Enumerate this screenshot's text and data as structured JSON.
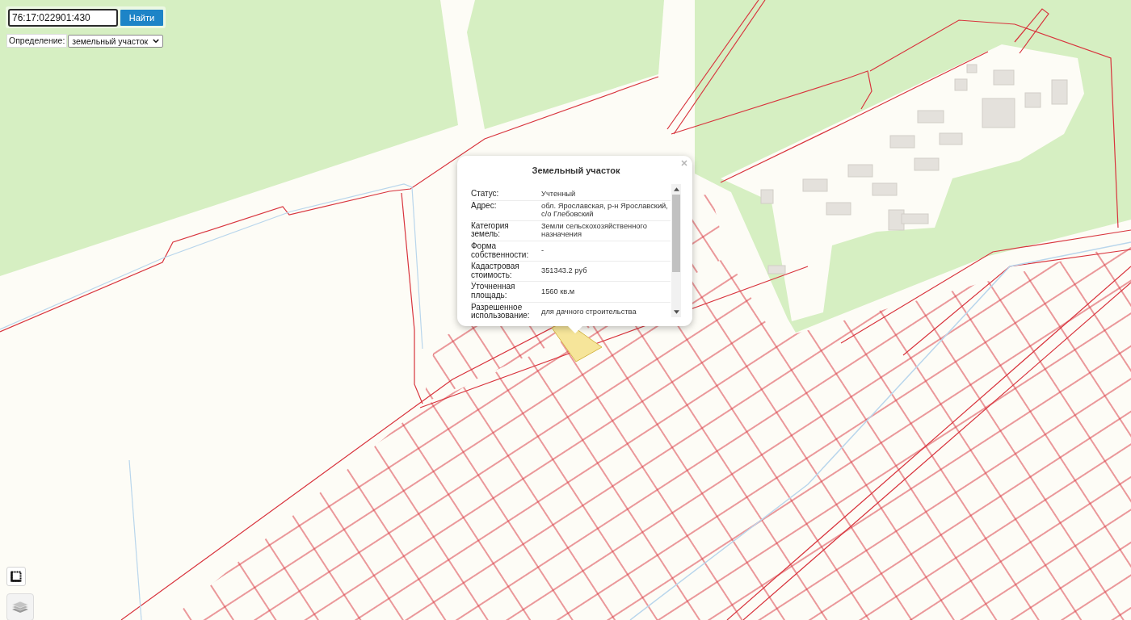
{
  "search": {
    "value": "76:17:022901:430",
    "button": "Найти"
  },
  "definition": {
    "label": "Определение:",
    "value": "земельный участок"
  },
  "popup": {
    "title": "Земельный участок",
    "rows": [
      {
        "label": "Статус:",
        "value": "Учтенный"
      },
      {
        "label": "Адрес:",
        "value": "обл. Ярославская, р-н Ярославский, с/о Глебовский"
      },
      {
        "label": "Категория земель:",
        "value": "Земли сельскохозяйственного назначения"
      },
      {
        "label": "Форма собственности:",
        "value": "-"
      },
      {
        "label": "Кадастровая стоимость:",
        "value": "351343.2 руб"
      },
      {
        "label": "Уточненная площадь:",
        "value": "1560 кв.м"
      },
      {
        "label": "Разрешенное использование:",
        "value": "для дачного строительства"
      }
    ]
  }
}
